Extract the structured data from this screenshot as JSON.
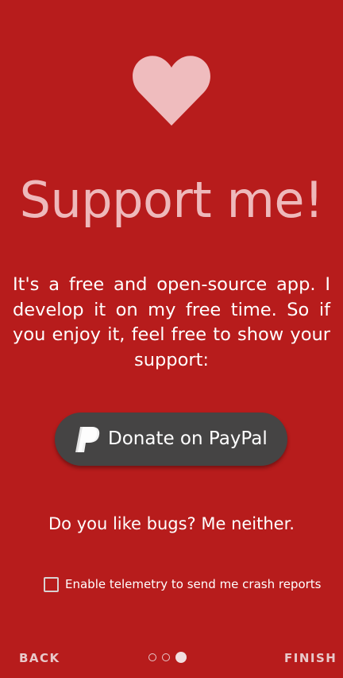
{
  "colors": {
    "background": "#b71c1c",
    "heart": "#efbcbe",
    "title": "#eeb9bb",
    "button": "#454444",
    "text": "#ffffff"
  },
  "hero": {
    "icon": "heart-icon",
    "title": "Support me!"
  },
  "description": "It's a free and open-source app. I develop it on my free time. So if you enjoy it, feel free to show your support:",
  "donate_button": {
    "icon": "paypal-icon",
    "label": "Donate on PayPal"
  },
  "bugs_text": "Do you like bugs? Me neither.",
  "telemetry": {
    "label": "Enable telemetry to send me crash reports",
    "checked": false
  },
  "nav": {
    "back_label": "BACK",
    "finish_label": "FINISH",
    "page_count": 3,
    "current_page": 3
  }
}
